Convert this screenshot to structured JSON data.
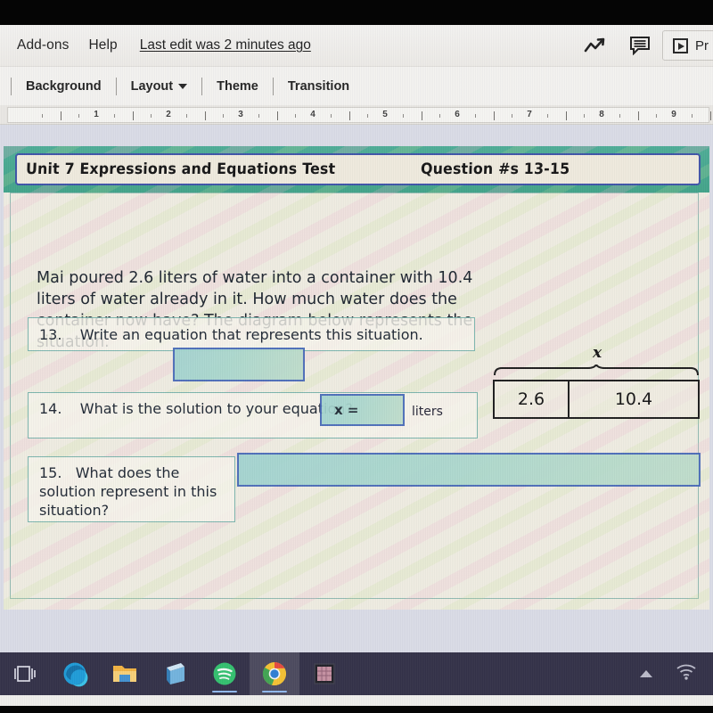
{
  "app": {
    "menubar": {
      "items": [
        {
          "label": "Add-ons",
          "name": "menu-addons"
        },
        {
          "label": "Help",
          "name": "menu-help"
        }
      ],
      "last_edit": "Last edit was 2 minutes ago",
      "icons": [
        {
          "name": "trending-up-icon",
          "glyph": "trend"
        },
        {
          "name": "comment-icon",
          "glyph": "comment"
        }
      ],
      "present_label": "Pr"
    },
    "toolbar": {
      "items": [
        {
          "label": "Background",
          "name": "toolbar-background",
          "caret": false
        },
        {
          "label": "Layout",
          "name": "toolbar-layout",
          "caret": true
        },
        {
          "label": "Theme",
          "name": "toolbar-theme",
          "caret": false
        },
        {
          "label": "Transition",
          "name": "toolbar-transition",
          "caret": false
        }
      ]
    },
    "ruler": {
      "marks": [
        "1",
        "2",
        "3",
        "4",
        "5",
        "6",
        "7",
        "8",
        "9"
      ]
    }
  },
  "slide": {
    "title": "Unit 7 Expressions and Equations Test",
    "title_question_range": "Question #s 13-15",
    "prompt": "Mai poured 2.6 liters of water into a container with 10.4 liters of water already in it. How much water does the container now have? The diagram below represents the situation.",
    "tape_diagram": {
      "brace_label": "x",
      "cells": [
        "2.6",
        "10.4"
      ]
    },
    "questions": [
      {
        "number": "13.",
        "text": "Write an equation that represents this situation.",
        "answer": ""
      },
      {
        "number": "14.",
        "text": "What is the solution to your equation?",
        "prefix": "x =",
        "unit": "liters",
        "answer": ""
      },
      {
        "number": "15.",
        "text": "What does the solution represent in this situation?",
        "answer": ""
      }
    ]
  },
  "taskbar": {
    "items": [
      {
        "name": "task-view-icon",
        "label": "Task View"
      },
      {
        "name": "edge-icon",
        "label": "Microsoft Edge"
      },
      {
        "name": "file-explorer-icon",
        "label": "File Explorer"
      },
      {
        "name": "office-app-icon",
        "label": "Office"
      },
      {
        "name": "spotify-icon",
        "label": "Spotify"
      },
      {
        "name": "chrome-icon",
        "label": "Google Chrome"
      },
      {
        "name": "app-icon",
        "label": "App"
      }
    ],
    "tray": [
      {
        "name": "chevron-up-icon",
        "label": "Show hidden icons"
      },
      {
        "name": "wifi-icon",
        "label": "Network"
      }
    ]
  },
  "colors": {
    "header_band": "#3ea287",
    "title_border": "#3b51a6",
    "answer_fill": "#a8d7cc",
    "answer_border": "#3f63b5",
    "question_border": "#79b3ab",
    "taskbar": "#2f2d44"
  }
}
